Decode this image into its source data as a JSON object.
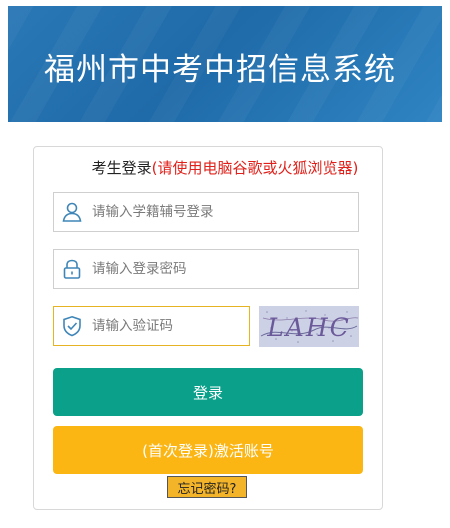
{
  "header": {
    "title": "福州市中考中招信息系统"
  },
  "login": {
    "heading": "考生登录",
    "hint": "(请使用电脑谷歌或火狐浏览器)",
    "username": {
      "placeholder": "请输入学籍辅号登录",
      "icon": "user-icon"
    },
    "password": {
      "placeholder": "请输入登录密码",
      "icon": "lock-icon"
    },
    "captcha": {
      "placeholder": "请输入验证码",
      "icon": "shield-check-icon",
      "image_text": "LAHC"
    },
    "login_button": "登录",
    "activate_button": "(首次登录)激活账号",
    "forgot_password": "忘记密码?"
  },
  "colors": {
    "banner": "#2a78b6",
    "login_button": "#0aa08a",
    "activate_button": "#fbb614",
    "hint": "#e0201a"
  }
}
